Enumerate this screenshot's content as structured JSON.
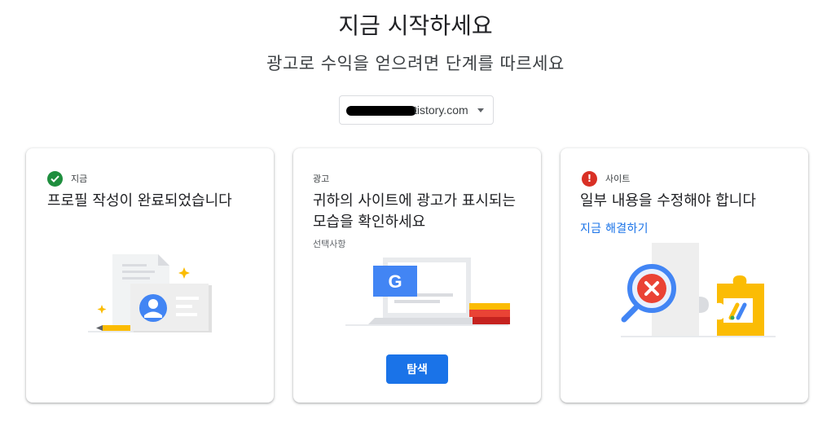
{
  "header": {
    "title": "지금 시작하세요",
    "subtitle": "광고로 수익을 얻으려면 단계를 따르세요"
  },
  "site_selector": {
    "value": "tistory.com"
  },
  "cards": [
    {
      "status": "지금",
      "status_icon": "check-circle-icon",
      "status_color": "#1e8e3e",
      "heading": "프로필 작성이 완료되었습니다"
    },
    {
      "status": "광고",
      "heading": "귀하의 사이트에 광고가 표시되는 모습을 확인하세요",
      "optional": "선택사항",
      "button": "탐색",
      "button_color": "#1a73e8"
    },
    {
      "status": "사이트",
      "status_icon": "alert-circle-icon",
      "status_color": "#d93025",
      "heading": "일부 내용을 수정해야 합니다",
      "link": "지금 해결하기",
      "link_color": "#1a73e8"
    }
  ]
}
